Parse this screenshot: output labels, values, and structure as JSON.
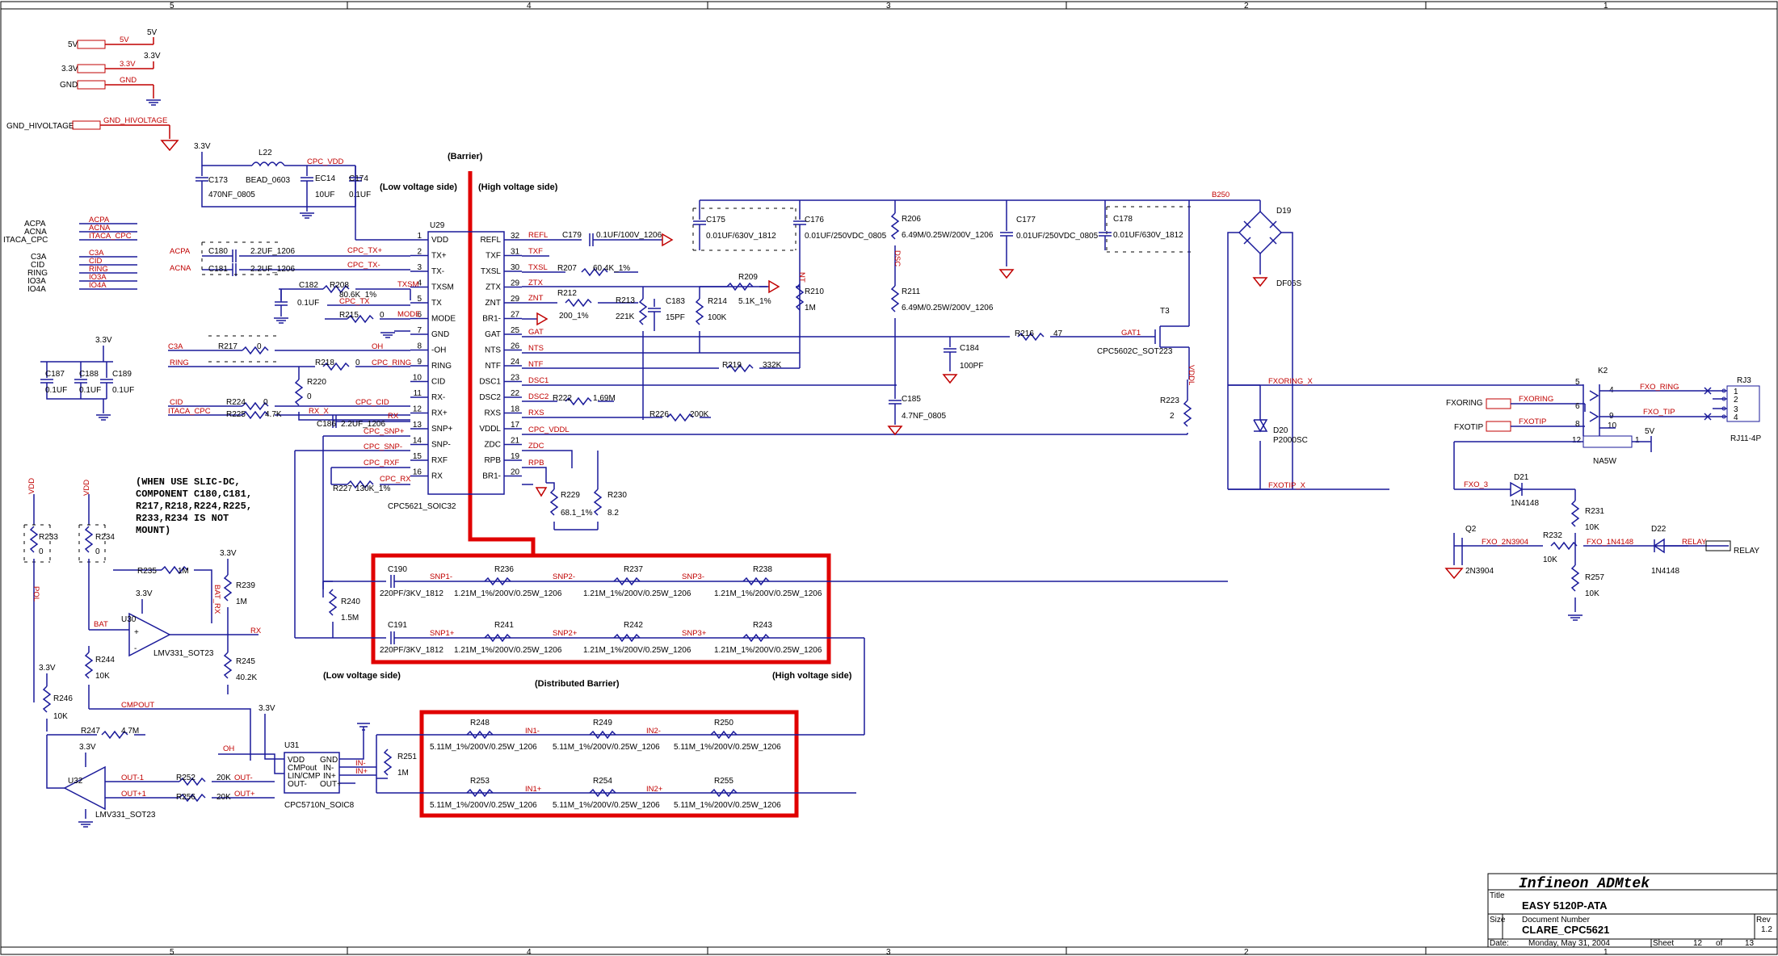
{
  "sheet_zones": [
    "5",
    "4",
    "3",
    "2",
    "1"
  ],
  "labels": {
    "barrier": "(Barrier)",
    "low_voltage_side": "(Low voltage side)",
    "high_voltage_side": "(High voltage side)",
    "distributed_barrier": "(Distributed Barrier)",
    "note": [
      "(WHEN USE SLIC-DC,",
      "COMPONENT C180,C181,",
      "R217,R218,R224,R225,",
      "R233,R234 IS NOT",
      "MOUNT)"
    ]
  },
  "power": {
    "v5": "5V",
    "v33": "3.3V",
    "gnd": "GND",
    "gnd_hv": "GND_HIVOLTAGE"
  },
  "inputs": [
    "ACPA",
    "ACNA",
    "ITACA_CPC",
    "C3A",
    "CID",
    "RING",
    "IO3A",
    "IO4A"
  ],
  "u29": {
    "ref": "U29",
    "part": "CPC5621_SOIC32",
    "left_pins": [
      {
        "n": "1",
        "name": "VDD"
      },
      {
        "n": "2",
        "name": "TX+"
      },
      {
        "n": "3",
        "name": "TX-"
      },
      {
        "n": "4",
        "name": "TXSM"
      },
      {
        "n": "5",
        "name": "TX"
      },
      {
        "n": "6",
        "name": "MODE"
      },
      {
        "n": "7",
        "name": "GND"
      },
      {
        "n": "8",
        "name": "-OH"
      },
      {
        "n": "9",
        "name": "RING"
      },
      {
        "n": "10",
        "name": "CID"
      },
      {
        "n": "11",
        "name": "RX-"
      },
      {
        "n": "12",
        "name": "RX+"
      },
      {
        "n": "13",
        "name": "SNP+"
      },
      {
        "n": "14",
        "name": "SNP-"
      },
      {
        "n": "15",
        "name": "RXF"
      },
      {
        "n": "16",
        "name": "RX"
      }
    ],
    "right_pins": [
      {
        "n": "32",
        "name": "REFL"
      },
      {
        "n": "31",
        "name": "TXF"
      },
      {
        "n": "30",
        "name": "TXSL"
      },
      {
        "n": "29",
        "name": "ZTX"
      },
      {
        "n": "29",
        "name": "ZNT"
      },
      {
        "n": "27",
        "name": "BR1-"
      },
      {
        "n": "25",
        "name": "GAT"
      },
      {
        "n": "26",
        "name": "NTS"
      },
      {
        "n": "24",
        "name": "NTF"
      },
      {
        "n": "23",
        "name": "DSC1"
      },
      {
        "n": "22",
        "name": "DSC2"
      },
      {
        "n": "18",
        "name": "RXS"
      },
      {
        "n": "17",
        "name": "VDDL"
      },
      {
        "n": "21",
        "name": "ZDC"
      },
      {
        "n": "19",
        "name": "RPB"
      },
      {
        "n": "20",
        "name": "BR1-"
      }
    ]
  },
  "top": {
    "c173": "C173",
    "c173v": "470NF_0805",
    "l22": "L22",
    "l22v": "BEAD_0603",
    "cpc_vdd": "CPC_VDD",
    "ec14": "EC14",
    "ec14v": "10UF",
    "c174": "C174",
    "c174v": "0.1UF",
    "c180": "C180",
    "c180v": "2.2UF_1206",
    "c181": "C181",
    "c181v": "2.2UF_1206",
    "cpc_txp": "CPC_TX+",
    "cpc_txm": "CPC_TX-",
    "r208": "R208",
    "r208v": "80.6K_1%",
    "txsm": "TXSM",
    "c182": "C182",
    "c182v": "0.1UF",
    "cpc_tx": "CPC_TX",
    "r215": "R215",
    "r215v": "0",
    "mode": "MODE",
    "c3a": "C3A",
    "r217": "R217",
    "r217v": "0",
    "oh": "OH",
    "ring": "RING",
    "r218": "R218",
    "r218v": "0",
    "cpc_ring": "CPC_RING",
    "r220": "R220",
    "r220v": "0",
    "cid": "CID",
    "itaca": "ITACA_CPC",
    "r224": "R224",
    "r224v": "0",
    "r225": "R225",
    "r225v": "4.7K",
    "cpc_cid": "CPC_CID",
    "rx_x": "RX_X",
    "c186": "C186",
    "c186v": "2.2UF_1206",
    "rx": "RX",
    "cpc_snpp": "CPC_SNP+",
    "cpc_snpm": "CPC_SNP-",
    "cpc_rxf": "CPC_RXF",
    "cpc_rx": "CPC_RX",
    "r227": "R227",
    "r227v": "130K_1%"
  },
  "right": {
    "refl": "REFL",
    "c179": "C179",
    "c179v": "0.1UF/100V_1206",
    "txf": "TXF",
    "txsl": "TXSL",
    "r207": "R207",
    "r207v": "60.4K_1%",
    "ztx": "ZTX",
    "znt": "ZNT",
    "r212": "R212",
    "r212v": "200_1%",
    "r213": "R213",
    "r213v": "221K",
    "c183": "C183",
    "c183v": "15PF",
    "r214": "R214",
    "r214v": "100K",
    "r209": "R209",
    "r209v": "5.1K_1%",
    "gat": "GAT",
    "nts": "NTS",
    "ntf": "NTF",
    "r219": "R219",
    "r219v": "332K",
    "dsc1": "DSC1",
    "dsc2": "DSC2",
    "r222": "R222",
    "r222v": "1.69M",
    "rxs": "RXS",
    "r226": "R226",
    "r226v": "200K",
    "cpc_vddl": "CPC_VDDL",
    "zdc": "ZDC",
    "rpb": "RPB",
    "r229": "R229",
    "r229v": "68.1_1%",
    "r230": "R230",
    "r230v": "8.2",
    "c175": "C175",
    "c175v": "0.01UF/630V_1812",
    "c176": "C176",
    "c176v": "0.01UF/250VDC_0805",
    "r206": "R206",
    "r206v": "6.49M/0.25W/200V_1206",
    "r211": "R211",
    "r211v": "6.49M/0.25W/200V_1206",
    "r210": "R210",
    "r210v": "1M",
    "c177": "C177",
    "c177v": "0.01UF/250VDC_0805",
    "c178": "C178",
    "c178v": "0.01UF/630V_1812",
    "b250": "B250",
    "d19": "D19",
    "d19v": "DF06S",
    "c184": "C184",
    "c184v": "100PF",
    "r216": "R216",
    "r216v": "47",
    "gat1": "GAT1",
    "t3": "T3",
    "t3v": "CPC5602C_SOT223",
    "c185": "C185",
    "c185v": "4.7NF_0805",
    "dsc": "DSC",
    "nt": "NT",
    "vddl": "VDDL",
    "r223": "R223",
    "r223v": "2"
  },
  "phone": {
    "fxoring_x": "FXORING_X",
    "fxotip_x": "FXOTIP_X",
    "k2": "K2",
    "k2v": "NA5W",
    "rj3": "RJ3",
    "rj3v": "RJ11-4P",
    "fxo_ring": "FXO_RING",
    "fxo_tip": "FXO_TIP",
    "fxoring": "FXORING",
    "fxotip": "FXOTIP",
    "d20": "D20",
    "d20v": "P2000SC",
    "v5": "5V",
    "fxo3": "FXO_3",
    "d21": "D21",
    "d21v": "1N4148",
    "r231": "R231",
    "r231v": "10K",
    "q2": "Q2",
    "q2v": "2N3904",
    "r232": "R232",
    "r232v": "10K",
    "fxo_2n3904": "FXO_2N3904",
    "fxo_1n4148": "FXO_1N4148",
    "d22": "D22",
    "d22v": "1N4148",
    "relay": "RELAY",
    "relay_lbl": "RELAY",
    "r257": "R257",
    "r257v": "10K",
    "rj_pins": [
      "1",
      "2",
      "3",
      "4"
    ]
  },
  "barrier_box": {
    "c190": "C190",
    "c190v": "220PF/3KV_1812",
    "c191": "C191",
    "c191v": "220PF/3KV_1812",
    "snp1m": "SNP1-",
    "snp2m": "SNP2-",
    "snp3m": "SNP3-",
    "snp1p": "SNP1+",
    "snp2p": "SNP2+",
    "snp3p": "SNP3+",
    "top_res": [
      {
        "ref": "R236",
        "val": "1.21M_1%/200V/0.25W_1206"
      },
      {
        "ref": "R237",
        "val": "1.21M_1%/200V/0.25W_1206"
      },
      {
        "ref": "R238",
        "val": "1.21M_1%/200V/0.25W_1206"
      }
    ],
    "bot_res": [
      {
        "ref": "R241",
        "val": "1.21M_1%/200V/0.25W_1206"
      },
      {
        "ref": "R242",
        "val": "1.21M_1%/200V/0.25W_1206"
      },
      {
        "ref": "R243",
        "val": "1.21M_1%/200V/0.25W_1206"
      }
    ],
    "r240": "R240",
    "r240v": "1.5M"
  },
  "bottom_box": {
    "in1m": "IN1-",
    "in2m": "IN2-",
    "in1p": "IN1+",
    "in2p": "IN2+",
    "top_res": [
      {
        "ref": "R248",
        "val": "5.11M_1%/200V/0.25W_1206"
      },
      {
        "ref": "R249",
        "val": "5.11M_1%/200V/0.25W_1206"
      },
      {
        "ref": "R250",
        "val": "5.11M_1%/200V/0.25W_1206"
      }
    ],
    "bot_res": [
      {
        "ref": "R253",
        "val": "5.11M_1%/200V/0.25W_1206"
      },
      {
        "ref": "R254",
        "val": "5.11M_1%/200V/0.25W_1206"
      },
      {
        "ref": "R255",
        "val": "5.11M_1%/200V/0.25W_1206"
      }
    ],
    "r251": "R251",
    "r251v": "1M"
  },
  "left_bottom": {
    "pol": "POL",
    "vdd": "VDD",
    "r233": "R233",
    "r233v": "0",
    "r234": "R234",
    "r234v": "0",
    "v33": "3.3V",
    "r235": "R235",
    "r235v": "1M",
    "r239": "R239",
    "r239v": "1M",
    "bat": "BAT",
    "bat_rx": "BAT_RX",
    "u30": "U30",
    "u30v": "LMV331_SOT23",
    "rx": "RX",
    "r244": "R244",
    "r244v": "10K",
    "r245": "R245",
    "r245v": "40.2K",
    "r246": "R246",
    "r246v": "10K",
    "cmpout": "CMPOUT",
    "r247": "R247",
    "r247v": "4.7M",
    "oh": "OH",
    "u31": "U31",
    "u31v": "CPC5710N_SOIC8",
    "u31_left": [
      "VDD",
      "CMPout",
      "LIN/CMP",
      "OUT-"
    ],
    "u31_right": [
      "GND",
      "IN-",
      "IN+",
      "OUT+"
    ],
    "u32": "U32",
    "u32v": "LMV331_SOT23",
    "out1m": "OUT-1",
    "out1p": "OUT+1",
    "r252": "R252",
    "r252v": "20K",
    "r256": "R256",
    "r256v": "20K",
    "outm": "OUT-",
    "outp": "OUT+",
    "inm": "IN-",
    "inp": "IN+"
  },
  "title_block": {
    "company": "Infineon ADMtek",
    "title_lbl": "Title",
    "title": "EASY 5120P-ATA",
    "size_lbl": "Size",
    "docnum_lbl": "Document Number",
    "docnum": "CLARE_CPC5621",
    "rev_lbl": "Rev",
    "rev": "1.2",
    "date_lbl": "Date:",
    "date": "Monday, May 31, 2004",
    "sheet_lbl": "Sheet",
    "sheet": "12",
    "of_lbl": "of",
    "of": "13"
  }
}
